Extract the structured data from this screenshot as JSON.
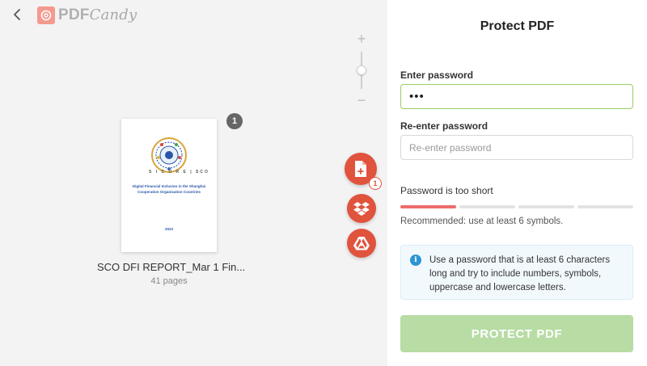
{
  "header": {
    "logo_pdf": "PDF",
    "logo_candy": "Candy"
  },
  "zoom": {
    "plus": "+",
    "minus": "−",
    "level": 0.5
  },
  "file": {
    "thumbnail": {
      "logos": "S I C U R E | SCO",
      "title": "Digital Financial Inclusion in the Shanghai Cooperation Organisation Countries",
      "year": "2023"
    },
    "badge": "1",
    "name": "SCO DFI REPORT_Mar 1 Fin...",
    "pages": "41 pages"
  },
  "actions": {
    "add_count": "1"
  },
  "panel": {
    "title": "Protect PDF",
    "password_label": "Enter password",
    "password_value": "•••",
    "reenter_label": "Re-enter password",
    "reenter_placeholder": "Re-enter password",
    "strength_text": "Password is too short",
    "strength_level": 1,
    "strength_segments": 4,
    "recommend": "Recommended: use at least 6 symbols.",
    "info": "Use a password that is at least 6 characters long and try to include numbers, symbols, uppercase and lowercase letters.",
    "button": "PROTECT PDF"
  },
  "colors": {
    "accent_red": "#e0533d",
    "button_disabled": "#b7dca4",
    "valid_border": "#9ccc65",
    "strength_weak": "#ef6c6c",
    "info_blue": "#2e95d3"
  }
}
